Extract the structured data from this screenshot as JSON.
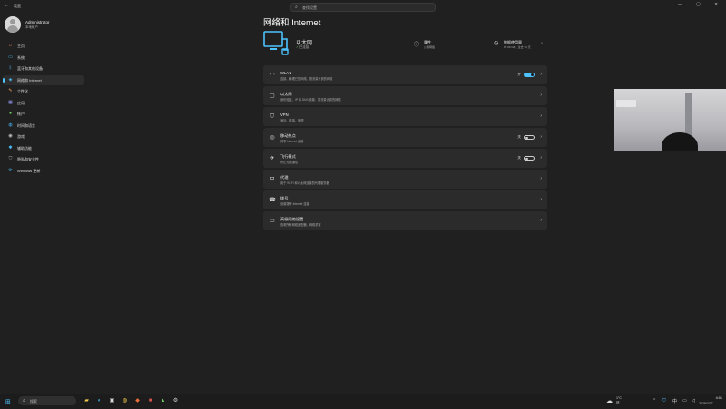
{
  "window": {
    "title": "设置",
    "search_placeholder": "查找设置"
  },
  "user": {
    "name": "Administrator",
    "role": "本地帐户"
  },
  "sidebar": {
    "items": [
      {
        "label": "主页",
        "icon": "home-icon",
        "color": "#ff8f6b"
      },
      {
        "label": "系统",
        "icon": "system-icon",
        "color": "#4cc2ff"
      },
      {
        "label": "蓝牙和其他设备",
        "icon": "bluetooth-icon",
        "color": "#4cc2ff"
      },
      {
        "label": "网络和 Internet",
        "icon": "network-icon",
        "color": "#4cc2ff",
        "active": true
      },
      {
        "label": "个性化",
        "icon": "brush-icon",
        "color": "#f0a060"
      },
      {
        "label": "应用",
        "icon": "apps-icon",
        "color": "#9aa0ff"
      },
      {
        "label": "帐户",
        "icon": "account-icon",
        "color": "#6ccb5f"
      },
      {
        "label": "时间和语言",
        "icon": "globe-icon",
        "color": "#4cc2ff"
      },
      {
        "label": "游戏",
        "icon": "game-icon",
        "color": "#cccccc"
      },
      {
        "label": "辅助功能",
        "icon": "accessibility-icon",
        "color": "#4cc2ff"
      },
      {
        "label": "隐私和安全性",
        "icon": "shield-icon",
        "color": "#aaaaaa"
      },
      {
        "label": "Windows 更新",
        "icon": "update-icon",
        "color": "#4cc2ff"
      }
    ]
  },
  "main": {
    "title": "网络和 Internet",
    "ethernet": {
      "name": "以太网",
      "status": "已连接"
    },
    "properties": {
      "title": "属性",
      "sub": "公用网络"
    },
    "data_usage": {
      "title": "数据使用量",
      "sub": "97.99 GB，过去 30 天"
    },
    "cards": [
      {
        "title": "WLAN",
        "sub": "连接、管理已知网络、按流量计费的网络",
        "icon": "wifi-icon",
        "toggle": "on",
        "toggle_label": "开"
      },
      {
        "title": "以太网",
        "sub": "身份验证、IP 和 DNS 设置、按流量计费的网络",
        "icon": "ethernet-icon"
      },
      {
        "title": "VPN",
        "sub": "添加、连接、管理",
        "icon": "vpn-icon"
      },
      {
        "title": "移动热点",
        "sub": "共享 Internet 连接",
        "icon": "hotspot-icon",
        "toggle": "off",
        "toggle_label": "关"
      },
      {
        "title": "飞行模式",
        "sub": "停止无线通信",
        "icon": "airplane-icon",
        "toggle": "off",
        "toggle_label": "关"
      },
      {
        "title": "代理",
        "sub": "用于 Wi-Fi 和以太网连接的代理服务器",
        "icon": "proxy-icon"
      },
      {
        "title": "拨号",
        "sub": "设置拨号 Internet 连接",
        "icon": "dialup-icon"
      },
      {
        "title": "高级网络设置",
        "sub": "查看所有网络适配器，网络重置",
        "icon": "monitor-icon"
      }
    ]
  },
  "taskbar": {
    "search_label": "搜索",
    "weather_temp": "1°C",
    "weather_cond": "晴",
    "time": "4:01",
    "date": "2025/2/27",
    "apps": [
      "file-explorer-icon",
      "edge-icon",
      "store-icon",
      "chrome-icon",
      "app-icon",
      "app2-icon",
      "terminal-icon",
      "settings-icon"
    ]
  },
  "colors": {
    "accent": "#4cc2ff",
    "background": "#202020",
    "card": "#2b2b2b"
  }
}
